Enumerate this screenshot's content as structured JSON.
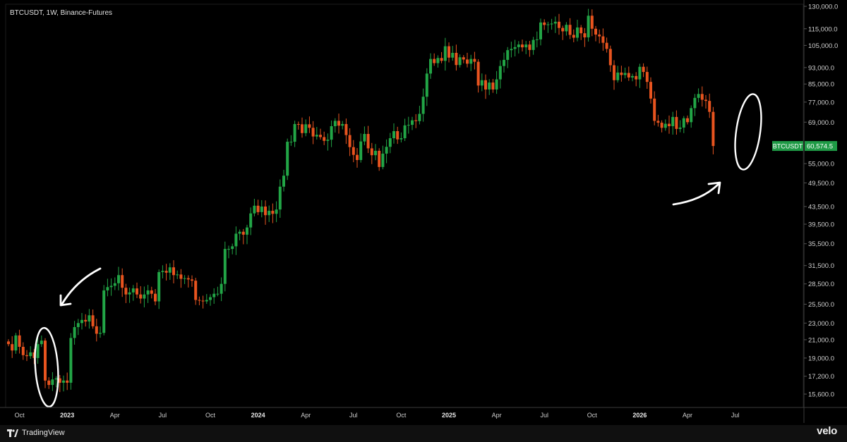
{
  "header": {
    "title": "BTCUSDT, 1W, Binance-Futures"
  },
  "footer": {
    "brand": "TradingView",
    "watermark": "velo"
  },
  "colors": {
    "up": "#22a546",
    "down": "#e8541f",
    "label_bg": "#1f9a46"
  },
  "chart_data": {
    "type": "candlestick",
    "title": "BTCUSDT, 1W, Binance-Futures",
    "y_scale": "log",
    "ylim": [
      14500,
      131500
    ],
    "y_ticks": [
      "130,000.0",
      "115,000.0",
      "105,000.0",
      "93,000.0",
      "85,000.0",
      "77,000.0",
      "69,000.0",
      "55,000.0",
      "49,500.0",
      "43,500.0",
      "39,500.0",
      "35,500.0",
      "31,500.0",
      "28,500.0",
      "25,500.0",
      "23,000.0",
      "21,000.0",
      "19,000.0",
      "17,200.0",
      "15,600.0"
    ],
    "y_tick_values": [
      130000,
      115000,
      105000,
      93000,
      85000,
      77000,
      69000,
      55000,
      49500,
      43500,
      39500,
      35500,
      31500,
      28500,
      25500,
      23000,
      21000,
      19000,
      17200,
      15600
    ],
    "x_ticks": [
      {
        "label": "Oct",
        "index": 3,
        "bold": false
      },
      {
        "label": "2023",
        "index": 16,
        "bold": true
      },
      {
        "label": "Apr",
        "index": 29,
        "bold": false
      },
      {
        "label": "Jul",
        "index": 42,
        "bold": false
      },
      {
        "label": "Oct",
        "index": 55,
        "bold": false
      },
      {
        "label": "2024",
        "index": 68,
        "bold": true
      },
      {
        "label": "Apr",
        "index": 81,
        "bold": false
      },
      {
        "label": "Jul",
        "index": 94,
        "bold": false
      },
      {
        "label": "Oct",
        "index": 107,
        "bold": false
      },
      {
        "label": "2025",
        "index": 120,
        "bold": true
      },
      {
        "label": "Apr",
        "index": 133,
        "bold": false
      },
      {
        "label": "Jul",
        "index": 146,
        "bold": false
      },
      {
        "label": "Oct",
        "index": 159,
        "bold": false
      },
      {
        "label": "2026",
        "index": 172,
        "bold": true
      },
      {
        "label": "Apr",
        "index": 185,
        "bold": false
      },
      {
        "label": "Jul",
        "index": 198,
        "bold": false
      }
    ],
    "last_price": {
      "label": "BTCUSDT",
      "value": "60,574.5"
    },
    "closes": [
      20500,
      19800,
      21500,
      20200,
      19300,
      19200,
      19600,
      19000,
      20500,
      20900,
      16800,
      16400,
      16900,
      17000,
      16600,
      16800,
      16600,
      21200,
      22500,
      23000,
      23400,
      23200,
      24000,
      22600,
      21700,
      21800,
      27500,
      28000,
      28200,
      28600,
      29900,
      27900,
      26900,
      27200,
      27800,
      26900,
      26300,
      26900,
      27500,
      27000,
      25900,
      30400,
      30600,
      30300,
      31200,
      29900,
      30000,
      29300,
      29400,
      29200,
      29000,
      26100,
      26000,
      25900,
      26100,
      26500,
      27000,
      27000,
      28500,
      34500,
      34500,
      35000,
      37500,
      37900,
      37300,
      38800,
      41900,
      43700,
      42200,
      43500,
      41500,
      42500,
      41800,
      42800,
      48500,
      51500,
      62000,
      62000,
      68300,
      68200,
      65000,
      68200,
      66900,
      63800,
      64400,
      63600,
      62300,
      62700,
      67500,
      69500,
      67700,
      68300,
      64300,
      60200,
      57700,
      56100,
      62100,
      64700,
      59800,
      57600,
      59000,
      54000,
      58100,
      60300,
      63200,
      65700,
      62800,
      63200,
      67800,
      68000,
      69700,
      69400,
      72200,
      79300,
      90000,
      97500,
      95300,
      98000,
      96500,
      104500,
      98200,
      100800,
      94300,
      98400,
      97200,
      95000,
      97500,
      96000,
      84300,
      86800,
      82500,
      85700,
      82500,
      87200,
      93800,
      97000,
      102300,
      103000,
      104000,
      105500,
      103900,
      105500,
      102400,
      108200,
      108500,
      119000,
      117400,
      117800,
      118300,
      119500,
      115500,
      113400,
      117500,
      111200,
      109500,
      115800,
      112200,
      109700,
      123500,
      115000,
      111400,
      110300,
      106500,
      103000,
      94200,
      86800,
      90500,
      89300,
      90300,
      88100,
      88800,
      87200,
      93400,
      90800,
      86000,
      78500,
      69500,
      68800,
      66900,
      68400,
      67500,
      71000,
      66500,
      67000,
      70500,
      69000,
      74500,
      78800,
      80500,
      78000,
      77500,
      73000,
      60574
    ]
  }
}
